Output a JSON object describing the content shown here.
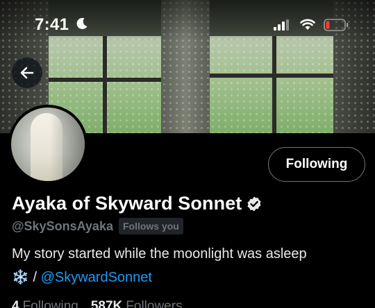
{
  "status_bar": {
    "time": "7:41",
    "icons": [
      "moon-icon",
      "signal-icon",
      "wifi-icon",
      "battery-icon"
    ]
  },
  "profile": {
    "display_name": "Ayaka of Skyward Sonnet",
    "handle": "@SkySonsAyaka",
    "follows_you_badge": "Follows you",
    "follow_button_label": "Following",
    "bio_line1": "My story started while the moonlight was asleep",
    "bio_emoji": "❄️",
    "bio_separator": " / ",
    "bio_link": "@SkywardSonnet"
  },
  "stats": {
    "following_count": "4",
    "following_label": "Following",
    "followers_count": "587K",
    "followers_label": "Followers"
  },
  "colors": {
    "accent": "#1d9bf0",
    "background": "#000000",
    "muted_text": "#71767b",
    "battery_low": "#ff3b30"
  }
}
